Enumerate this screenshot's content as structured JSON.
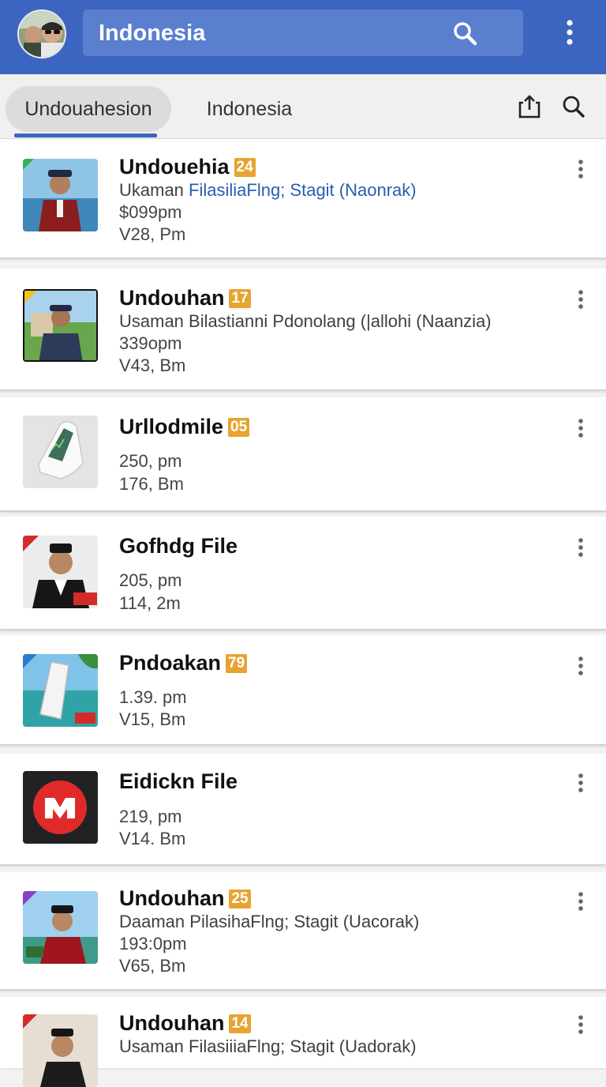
{
  "appbar": {
    "title": "Indonesia"
  },
  "tabs": [
    {
      "label": "Undouahesion"
    },
    {
      "label": "Indonesia"
    }
  ],
  "items": [
    {
      "title": "Undouehia",
      "badge": "24",
      "sub": "Ukaman ",
      "sub_link": "FilasiliaFlng; Stagit (Naonrak)",
      "line1": "$099pm",
      "line2": "V28, Pm"
    },
    {
      "title": "Undouhan",
      "badge": "17",
      "sub": "Usaman Bilastianni Pdonolang (|allohi (Naanzia)",
      "sub_link": "",
      "line1": "339opm",
      "line2": "V43, Bm"
    },
    {
      "title": "Urllodmile",
      "badge": "05",
      "sub": "",
      "sub_link": "",
      "line1": "250, pm",
      "line2": "176, Bm"
    },
    {
      "title": "Gofhdg File",
      "badge": "",
      "sub": "",
      "sub_link": "",
      "line1": "205, pm",
      "line2": "114, 2m"
    },
    {
      "title": "Pndoakan",
      "badge": "79",
      "sub": "",
      "sub_link": "",
      "line1": "1.39. pm",
      "line2": "V15, Bm"
    },
    {
      "title": "Eidickn File",
      "badge": "",
      "sub": "",
      "sub_link": "",
      "line1": "219, pm",
      "line2": "V14. Bm"
    },
    {
      "title": "Undouhan",
      "badge": "25",
      "sub": "Daaman PilasihaFlng; Stagit (Uacorak)",
      "sub_link": "",
      "line1": "193:0pm",
      "line2": "V65, Bm"
    },
    {
      "title": "Undouhan",
      "badge": "14",
      "sub": "Usaman FilasiiiaFlng; Stagit (Uadorak)",
      "sub_link": "",
      "line1": "",
      "line2": ""
    }
  ],
  "colors": {
    "appbar": "#3b65c0",
    "badge": "#e7a431",
    "link": "#2a5db0"
  },
  "icons": [
    "avatar",
    "search-icon",
    "overflow-menu-icon",
    "share-icon",
    "search-icon",
    "more-vert-icon"
  ]
}
